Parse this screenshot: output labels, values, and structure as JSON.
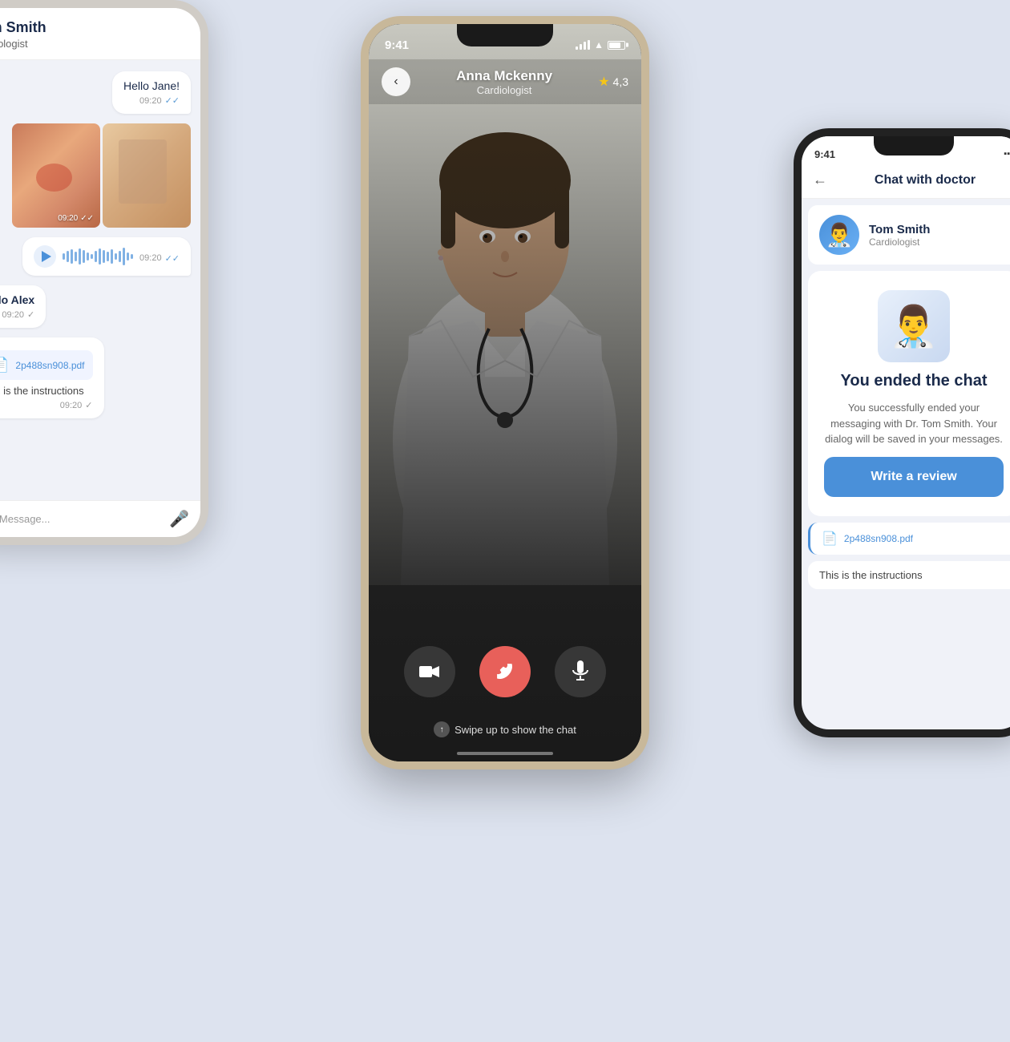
{
  "background_color": "#dde3ef",
  "left_phone": {
    "doctor_name": "Tom Smith",
    "doctor_title": "Cardiologist",
    "messages": [
      {
        "type": "right",
        "text": "Hello Jane!",
        "time": "09:20",
        "has_check": true
      },
      {
        "type": "right-images",
        "time": "09:20",
        "has_check": true
      },
      {
        "type": "right-audio",
        "time": "09:20",
        "has_check": true
      },
      {
        "type": "left",
        "text": "Hello Alex",
        "time": "09:20",
        "has_check": true
      },
      {
        "type": "left-pdf",
        "filename": "2p488sn908.pdf",
        "instructions": "This is the instructions",
        "time": "09:20",
        "has_check": true
      }
    ],
    "input_placeholder": "Message..."
  },
  "center_phone": {
    "time": "9:41",
    "doctor_name": "Anna Mckenny",
    "doctor_title": "Cardiologist",
    "rating": "4,3",
    "swipe_text": "Swipe up to show the chat",
    "controls": {
      "video": "video",
      "end_call": "phone",
      "mute": "mic"
    }
  },
  "right_phone": {
    "time": "9:41",
    "header_title": "Chat with doctor",
    "doctor_name": "Tom Smith",
    "doctor_title": "Cardiologist",
    "ended_title": "You ended the chat",
    "ended_description": "You successfully ended your messaging with Dr. Tom Smith. Your dialog will be saved in your messages.",
    "write_review_label": "Write a review",
    "pdf_filename": "2p488sn908.pdf",
    "instructions_text": "This is the instructions"
  }
}
